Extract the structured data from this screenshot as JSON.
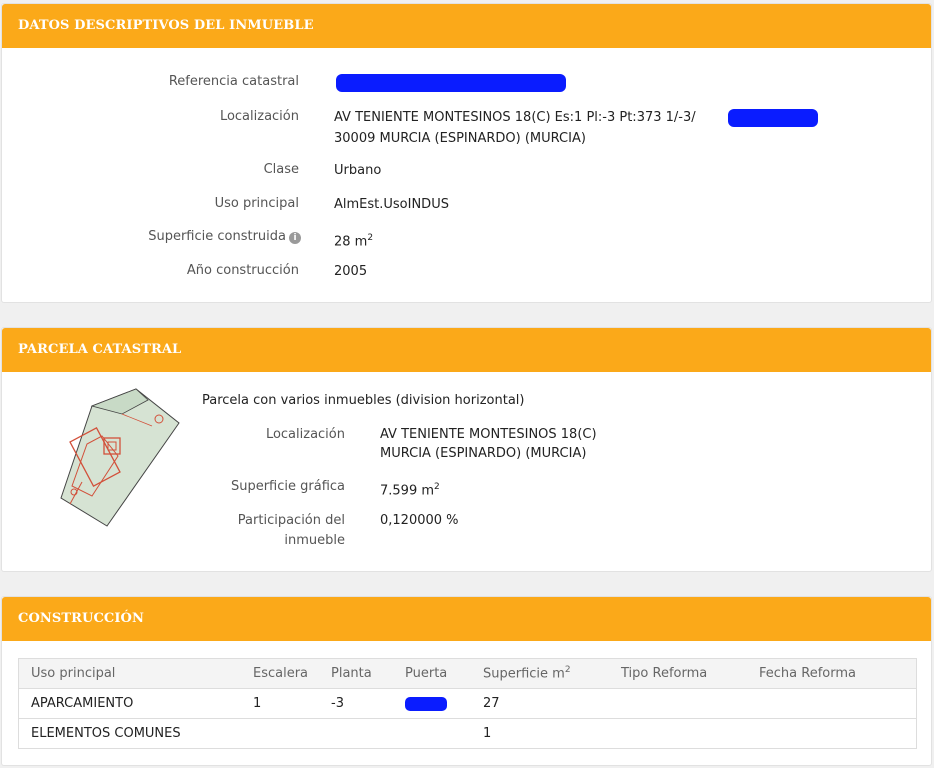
{
  "descriptivos": {
    "title": "DATOS DESCRIPTIVOS DEL INMUEBLE",
    "ref_label": "Referencia catastral",
    "loc_label": "Localización",
    "loc_line1": "AV TENIENTE MONTESINOS 18(C) Es:1 Pl:-3 Pt:373 1/-3/",
    "loc_line2": "30009 MURCIA (ESPINARDO) (MURCIA)",
    "clase_label": "Clase",
    "clase_value": "Urbano",
    "uso_label": "Uso principal",
    "uso_value": "AlmEst.UsoINDUS",
    "sup_label": "Superficie construida",
    "sup_value": "28 m",
    "sup_unit_sup": "2",
    "info_icon": "i",
    "anio_label": "Año construcción",
    "anio_value": "2005"
  },
  "parcela": {
    "title": "PARCELA CATASTRAL",
    "desc": "Parcela con varios inmuebles (division horizontal)",
    "loc_label": "Localización",
    "loc_line1": "AV TENIENTE MONTESINOS 18(C)",
    "loc_line2": "MURCIA (ESPINARDO) (MURCIA)",
    "sup_label": "Superficie gráfica",
    "sup_value": "7.599 m",
    "sup_unit_sup": "2",
    "part_label_1": "Participación del",
    "part_label_2": "inmueble",
    "part_value": "0,120000 %"
  },
  "construccion": {
    "title": "CONSTRUCCIÓN",
    "headers": {
      "uso": "Uso principal",
      "escalera": "Escalera",
      "planta": "Planta",
      "puerta": "Puerta",
      "superficie": "Superficie m",
      "superficie_sup": "2",
      "tipo": "Tipo Reforma",
      "fecha": "Fecha Reforma"
    },
    "rows": [
      {
        "uso": "APARCAMIENTO",
        "escalera": "1",
        "planta": "-3",
        "superficie": "27"
      },
      {
        "uso": "ELEMENTOS COMUNES",
        "escalera": "",
        "planta": "",
        "superficie": "1"
      }
    ]
  },
  "colors": {
    "header_bg": "#fba919",
    "redaction": "#0a1cff"
  }
}
